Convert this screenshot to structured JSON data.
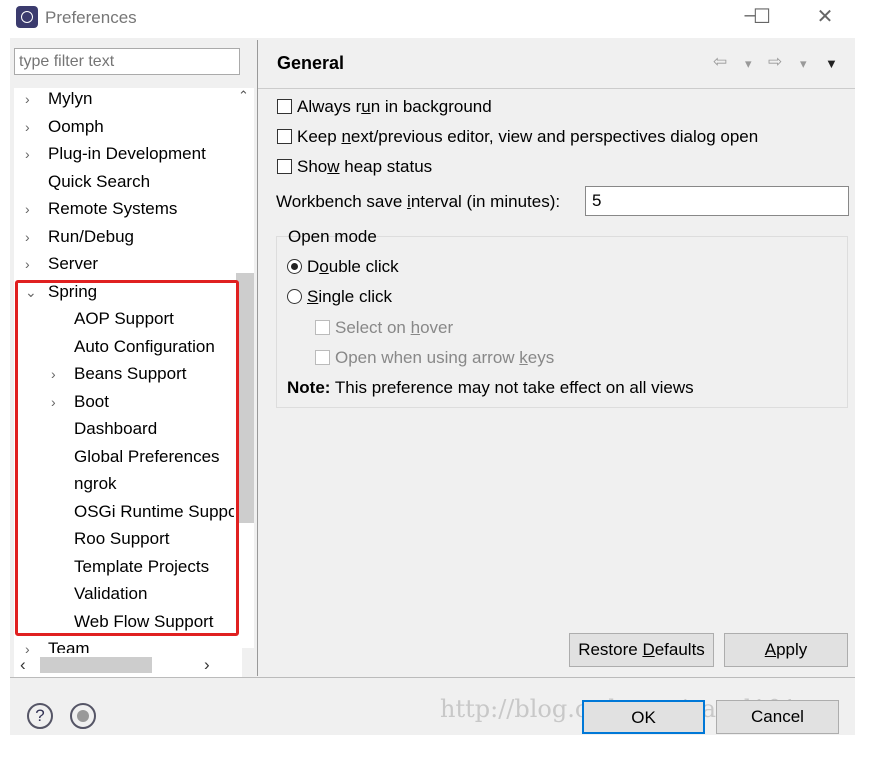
{
  "window": {
    "title": "Preferences",
    "minimize": "–",
    "maximize": "☐",
    "close": "✕"
  },
  "filter": {
    "placeholder": "type filter text"
  },
  "tree": [
    {
      "label": "Mylyn",
      "level": 0,
      "chevron": "›"
    },
    {
      "label": "Oomph",
      "level": 0,
      "chevron": "›"
    },
    {
      "label": "Plug-in Development",
      "level": 0,
      "chevron": "›"
    },
    {
      "label": "Quick Search",
      "level": 0,
      "chevron": ""
    },
    {
      "label": "Remote Systems",
      "level": 0,
      "chevron": "›"
    },
    {
      "label": "Run/Debug",
      "level": 0,
      "chevron": "›"
    },
    {
      "label": "Server",
      "level": 0,
      "chevron": "›"
    },
    {
      "label": "Spring",
      "level": 0,
      "chevron": "⌄"
    },
    {
      "label": "AOP Support",
      "level": 1,
      "chevron": ""
    },
    {
      "label": "Auto Configuration",
      "level": 1,
      "chevron": ""
    },
    {
      "label": "Beans Support",
      "level": 1,
      "chevron": "›"
    },
    {
      "label": "Boot",
      "level": 1,
      "chevron": "›"
    },
    {
      "label": "Dashboard",
      "level": 1,
      "chevron": ""
    },
    {
      "label": "Global Preferences",
      "level": 1,
      "chevron": ""
    },
    {
      "label": "ngrok",
      "level": 1,
      "chevron": ""
    },
    {
      "label": "OSGi Runtime Support",
      "level": 1,
      "chevron": ""
    },
    {
      "label": "Roo Support",
      "level": 1,
      "chevron": ""
    },
    {
      "label": "Template Projects",
      "level": 1,
      "chevron": ""
    },
    {
      "label": "Validation",
      "level": 1,
      "chevron": ""
    },
    {
      "label": "Web Flow Support",
      "level": 1,
      "chevron": ""
    },
    {
      "label": "Team",
      "level": 0,
      "chevron": "›"
    }
  ],
  "page": {
    "title": "General",
    "nav": {
      "back": "⇦",
      "back_menu": "▾",
      "forward": "⇨",
      "forward_menu": "▾",
      "menu": "▼"
    },
    "options": [
      {
        "pre": "Always r",
        "u": "u",
        "post": "n in background",
        "checked": false
      },
      {
        "pre": "Keep ",
        "u": "n",
        "post": "ext/previous editor, view and perspectives dialog open",
        "checked": false
      },
      {
        "pre": "Sho",
        "u": "w",
        "post": " heap status",
        "checked": false
      }
    ],
    "interval": {
      "pre": "Workbench save ",
      "u": "i",
      "post": "nterval (in minutes):",
      "value": "5"
    },
    "open_mode": {
      "label": "Open mode",
      "double": {
        "pre": "D",
        "u": "o",
        "post": "uble click",
        "selected": true
      },
      "single": {
        "pre": "",
        "u": "S",
        "post": "ingle click",
        "selected": false
      },
      "hover": {
        "pre": "Select on ",
        "u": "h",
        "post": "over",
        "checked": false
      },
      "arrow": {
        "pre": "Open when using arrow ",
        "u": "k",
        "post": "eys",
        "checked": false
      },
      "note_bold": "Note:",
      "note": " This preference may not take effect on all views"
    },
    "restore": {
      "pre": "Restore ",
      "u": "D",
      "post": "efaults"
    },
    "apply": {
      "pre": "",
      "u": "A",
      "post": "pply"
    }
  },
  "footer": {
    "help": "?",
    "ok": "OK",
    "cancel": "Cancel",
    "watermark": "http://blog.csdn.net/pavel101"
  }
}
